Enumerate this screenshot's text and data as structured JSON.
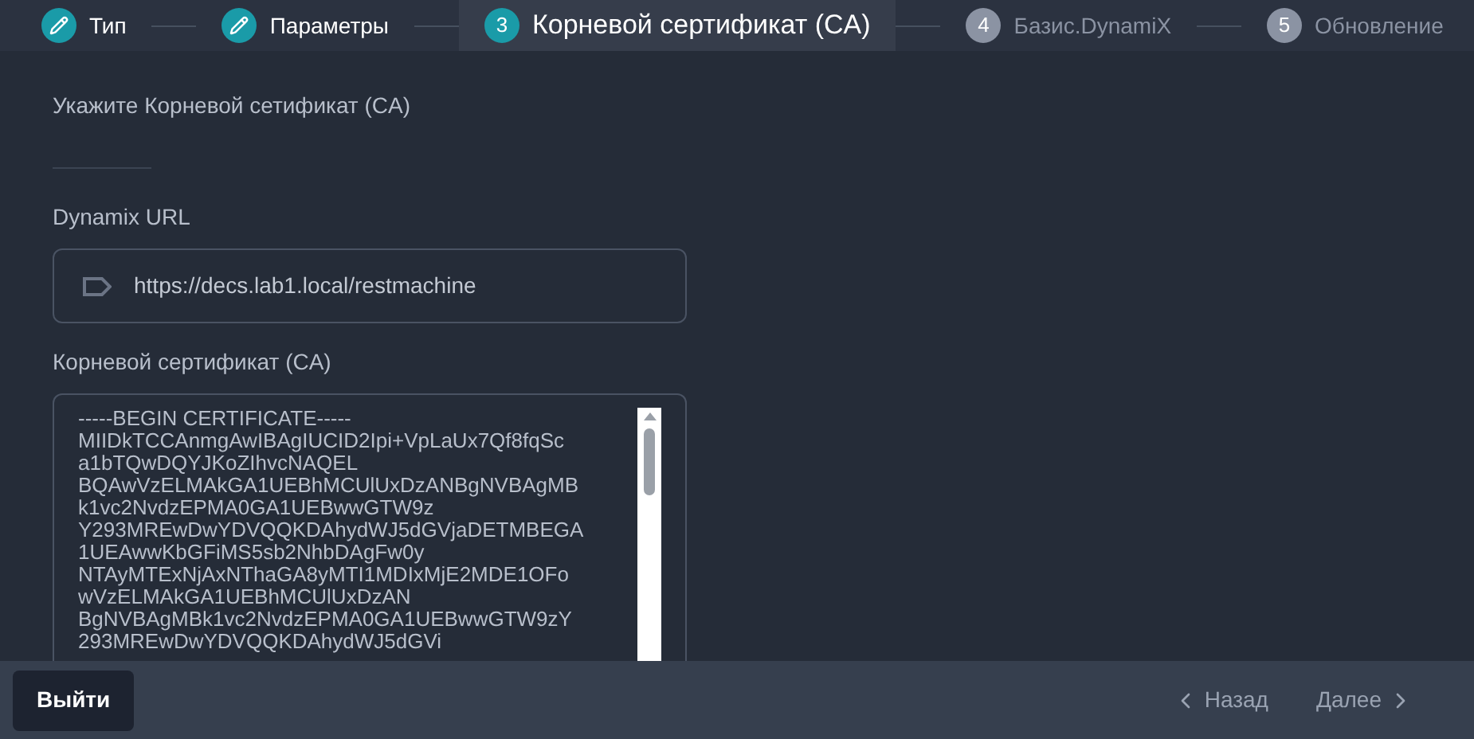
{
  "steps": [
    {
      "label": "Тип",
      "completed": true,
      "selected": false
    },
    {
      "label": "Параметры",
      "completed": true,
      "selected": false
    },
    {
      "number": "3",
      "label": "Корневой сертификат (CA)",
      "completed": false,
      "selected": true
    },
    {
      "number": "4",
      "label": "Базис.DynamiX",
      "completed": false,
      "selected": false
    },
    {
      "number": "5",
      "label": "Обновление",
      "completed": false,
      "selected": false
    }
  ],
  "heading": "Укажите Корневой сетификат (CA)",
  "url_field": {
    "label": "Dynamix URL",
    "value": "https://decs.lab1.local/restmachine"
  },
  "certificate_field": {
    "label": "Корневой сертификат (CA)",
    "lines": [
      "-----BEGIN CERTIFICATE-----",
      "MIIDkTCCAnmgAwIBAgIUCID2Ipi+VpLaUx7Qf8fqSc",
      "a1bTQwDQYJKoZIhvcNAQEL",
      "BQAwVzELMAkGA1UEBhMCUlUxDzANBgNVBAgMB",
      "k1vc2NvdzEPMA0GA1UEBwwGTW9z",
      "Y293MREwDwYDVQQKDAhydWJ5dGVjaDETMBEGA",
      "1UEAwwKbGFiMS5sb2NhbDAgFw0y",
      "NTAyMTExNjAxNThaGA8yMTI1MDIxMjE2MDE1OFo",
      "wVzELMAkGA1UEBhMCUlUxDzAN",
      "BgNVBAgMBk1vc2NvdzEPMA0GA1UEBwwGTW9zY",
      "293MREwDwYDVQQKDAhydWJ5dGVi"
    ]
  },
  "footer": {
    "exit": "Выйти",
    "back": "Назад",
    "next": "Далее"
  }
}
